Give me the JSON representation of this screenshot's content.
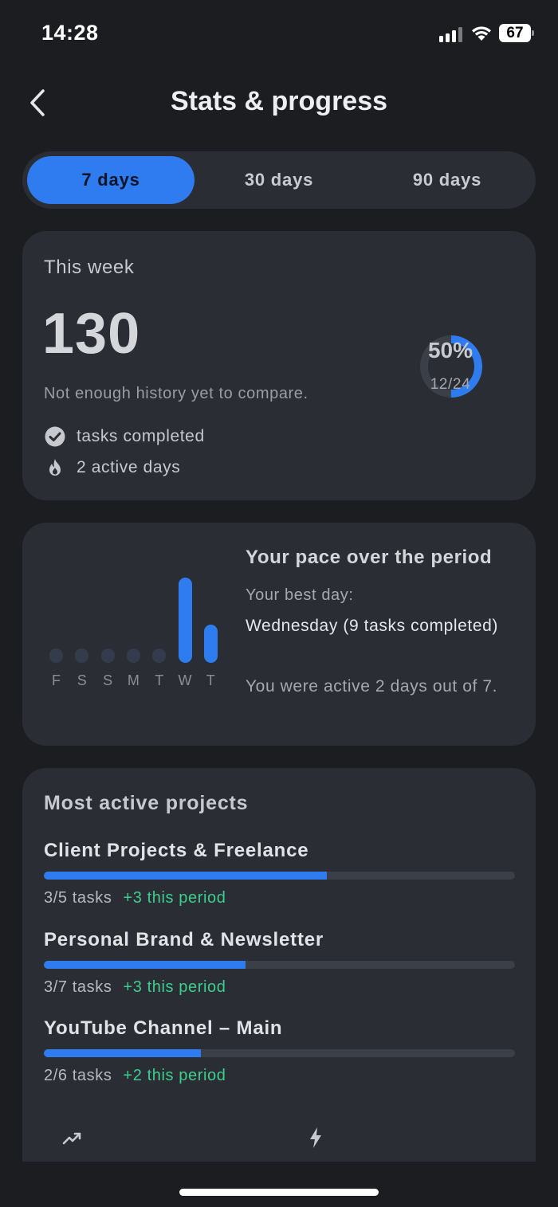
{
  "status_bar": {
    "time": "14:28",
    "battery": "67"
  },
  "header": {
    "title": "Stats & progress"
  },
  "tabs": [
    {
      "label": "7 days",
      "active": true
    },
    {
      "label": "30 days",
      "active": false
    },
    {
      "label": "90 days",
      "active": false
    }
  ],
  "week": {
    "label": "This week",
    "value": "130",
    "compare_text": "Not enough history yet to compare.",
    "tasks_label": "tasks completed",
    "active_days_label": "2 active days",
    "progress_percent": "50%",
    "progress_fraction": "12/24",
    "progress_ratio": 0.5
  },
  "pace": {
    "title": "Your pace over the period",
    "best_day_label": "Your best day:",
    "best_day_value": "Wednesday (9 tasks completed)",
    "active_text": "You were active 2 days out of 7.",
    "days": [
      {
        "label": "F",
        "tasks": 0
      },
      {
        "label": "S",
        "tasks": 0
      },
      {
        "label": "S",
        "tasks": 0
      },
      {
        "label": "M",
        "tasks": 0
      },
      {
        "label": "T",
        "tasks": 0
      },
      {
        "label": "W",
        "tasks": 9
      },
      {
        "label": "T",
        "tasks": 4
      }
    ]
  },
  "projects": {
    "heading": "Most active projects",
    "items": [
      {
        "name": "Client Projects & Freelance",
        "tasks": "3/5 tasks",
        "delta": "+3 this period",
        "progress": 0.6
      },
      {
        "name": "Personal Brand & Newsletter",
        "tasks": "3/7 tasks",
        "delta": "+3 this period",
        "progress": 0.4286
      },
      {
        "name": "YouTube Channel – Main",
        "tasks": "2/6 tasks",
        "delta": "+2 this period",
        "progress": 0.3333
      }
    ]
  },
  "colors": {
    "accent": "#2f7cf0",
    "positive": "#3ccf8e",
    "background": "#1b1d21",
    "card": "#2a2d33"
  },
  "icons": [
    "chevron-left-icon",
    "check-circle-icon",
    "flame-icon",
    "trending-up-icon",
    "lightning-icon",
    "signal-icon",
    "wifi-icon",
    "battery-icon"
  ]
}
